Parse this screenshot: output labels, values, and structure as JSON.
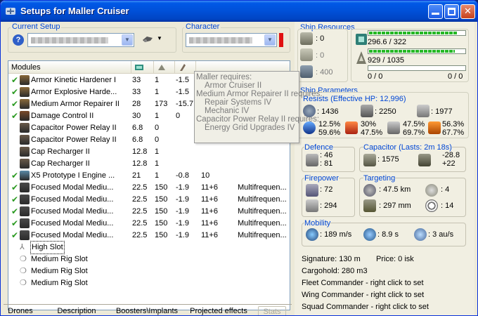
{
  "window": {
    "title": "Setups for Maller Cruiser"
  },
  "setup": {
    "group_label": "Current Setup",
    "character_label": "Character"
  },
  "modules_list": {
    "header": "Modules",
    "rows": [
      {
        "checked": true,
        "name": "Armor Kinetic Hardener I",
        "c1": "33",
        "c2": "1",
        "c3": "-1.5",
        "c4": "",
        "c5": "",
        "icon_color": "#8a6a3a"
      },
      {
        "checked": true,
        "name": "Armor Explosive Harde...",
        "c1": "33",
        "c2": "1",
        "c3": "-1.5",
        "c4": "",
        "c5": "",
        "icon_color": "#8a6a3a"
      },
      {
        "checked": true,
        "name": "Medium Armor Repairer II",
        "c1": "28",
        "c2": "173",
        "c3": "-15.7",
        "c4": "",
        "c5": "",
        "icon_color": "#8a6a3a"
      },
      {
        "checked": true,
        "name": "Damage Control II",
        "c1": "30",
        "c2": "1",
        "c3": "0",
        "c4": "",
        "c5": "",
        "icon_color": "#7a4a2a"
      },
      {
        "checked": false,
        "name": "Capacitor Power Relay II",
        "c1": "6.8",
        "c2": "0",
        "c3": "",
        "c4": "",
        "c5": "",
        "icon_color": "#6a5a4a"
      },
      {
        "checked": false,
        "name": "Capacitor Power Relay II",
        "c1": "6.8",
        "c2": "0",
        "c3": "",
        "c4": "",
        "c5": "",
        "icon_color": "#6a5a4a"
      },
      {
        "checked": false,
        "name": "Cap Recharger II",
        "c1": "12.8",
        "c2": "1",
        "c3": "",
        "c4": "",
        "c5": "",
        "icon_color": "#6a5a4a"
      },
      {
        "checked": false,
        "name": "Cap Recharger II",
        "c1": "12.8",
        "c2": "1",
        "c3": "",
        "c4": "",
        "c5": "",
        "icon_color": "#6a5a4a"
      },
      {
        "checked": true,
        "name": "X5 Prototype I Engine ...",
        "c1": "21",
        "c2": "1",
        "c3": "-0.8",
        "c4": "10",
        "c5": "",
        "icon_color": "#5a8aa8"
      },
      {
        "checked": true,
        "name": "Focused Modal Mediu...",
        "c1": "22.5",
        "c2": "150",
        "c3": "-1.9",
        "c4": "11+6",
        "c5": "Multifrequen...",
        "icon_color": "#4a4a4a"
      },
      {
        "checked": true,
        "name": "Focused Modal Mediu...",
        "c1": "22.5",
        "c2": "150",
        "c3": "-1.9",
        "c4": "11+6",
        "c5": "Multifrequen...",
        "icon_color": "#4a4a4a"
      },
      {
        "checked": true,
        "name": "Focused Modal Mediu...",
        "c1": "22.5",
        "c2": "150",
        "c3": "-1.9",
        "c4": "11+6",
        "c5": "Multifrequen...",
        "icon_color": "#4a4a4a"
      },
      {
        "checked": true,
        "name": "Focused Modal Mediu...",
        "c1": "22.5",
        "c2": "150",
        "c3": "-1.9",
        "c4": "11+6",
        "c5": "Multifrequen...",
        "icon_color": "#4a4a4a"
      },
      {
        "checked": true,
        "name": "Focused Modal Mediu...",
        "c1": "22.5",
        "c2": "150",
        "c3": "-1.9",
        "c4": "11+6",
        "c5": "Multifrequen...",
        "icon_color": "#4a4a4a"
      }
    ],
    "empty_slots": [
      "High Slot",
      "Medium Rig Slot",
      "Medium Rig Slot",
      "Medium Rig Slot"
    ]
  },
  "tooltip": {
    "lines": [
      "Maller requires:",
      "Armor Cruiser II",
      "Medium Armor Repairer II requires:",
      "Repair Systems IV",
      "Mechanic IV",
      "Capacitor Power Relay II requires:",
      "Energy Grid Upgrades IV"
    ]
  },
  "bottom_tabs": [
    "Drones",
    "Description",
    "Boosters\\Implants",
    "Projected effects",
    "Stats"
  ],
  "ship_resources": {
    "label": "Ship Resources",
    "turret": ": 0",
    "launcher": ": 0",
    "calibration": ": 400",
    "cpu": "296.6 / 322",
    "cpu_fraction": 0.921,
    "power": "929 / 1035",
    "power_fraction": 0.898,
    "drone_left": "0 / 0",
    "drone_right": "0 / 0"
  },
  "ship_parameters": {
    "label": "Ship Parameters",
    "resists_label": "Resists (Effective HP: 12,996)",
    "hp_shield": ": 1436",
    "hp_armor": ": 2250",
    "hp_structure": ": 1977",
    "resist_em": [
      "12.5%",
      "59.6%"
    ],
    "resist_therm": [
      "30%",
      "47.5%"
    ],
    "resist_kin": [
      "47.5%",
      "69.7%"
    ],
    "resist_exp": [
      "56.3%",
      "67.7%"
    ]
  },
  "defence": {
    "label": "Defence",
    "v1": ": 46",
    "v2": ": 81"
  },
  "capacitor": {
    "label": "Capacitor (Lasts: 2m 18s)",
    "v1": ": 1575",
    "v2": "-28.8",
    "v3": "+22"
  },
  "firepower": {
    "label": "Firepower",
    "v1": ": 72",
    "v2": ": 294"
  },
  "targeting": {
    "label": "Targeting",
    "range": ": 47.5 km",
    "targets": ": 4",
    "scan": ": 297 mm",
    "sensor": ": 14"
  },
  "mobility": {
    "label": "Mobility",
    "speed": ": 189 m/s",
    "align": ": 8.9 s",
    "warp": ": 3 au/s"
  },
  "summary": {
    "signature": "Signature: 130 m",
    "price": "Price: 0 isk",
    "cargohold": "Cargohold: 280 m3",
    "fleet": "Fleet Commander - right click to set",
    "wing": "Wing Commander - right click to set",
    "squad": "Squad Commander - right click to set"
  },
  "colors": {
    "accent": "#0046d5",
    "title_bar": "#0054e3",
    "window_bg": "#ece9d8"
  }
}
